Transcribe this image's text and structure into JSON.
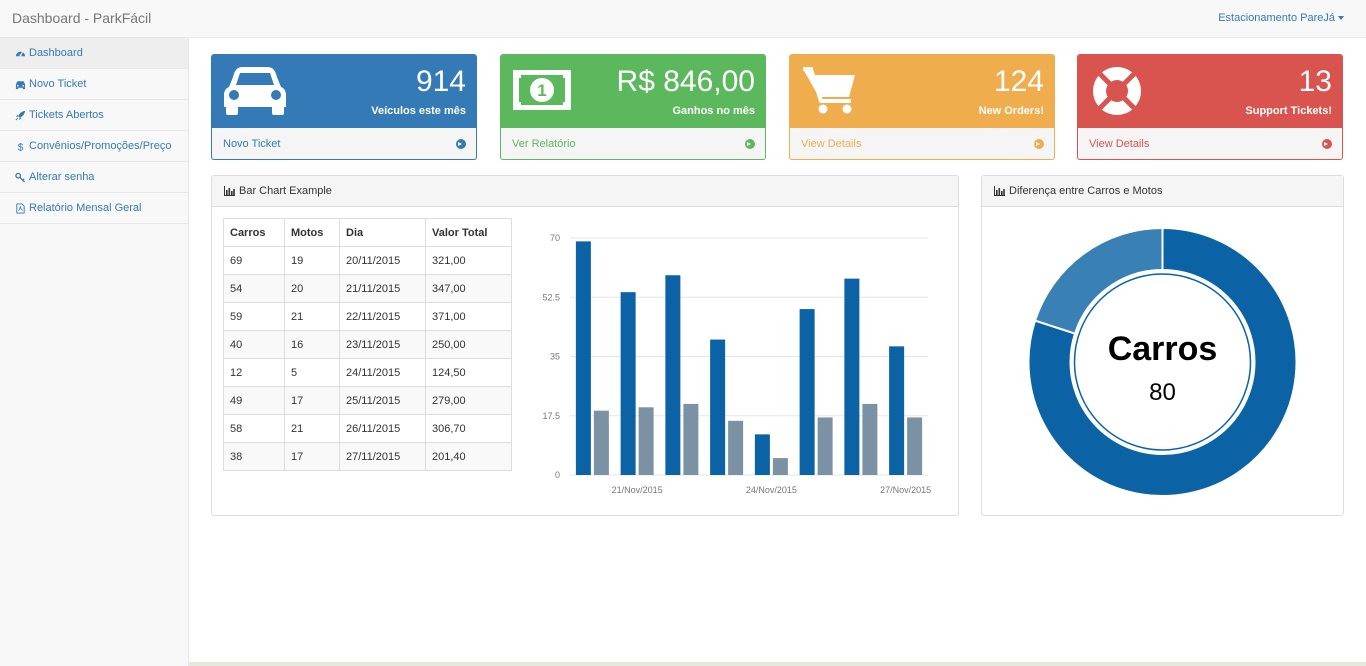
{
  "navbar": {
    "brand": "Dashboard - ParkFácil",
    "user": "Estacionamento PareJá"
  },
  "sidebar": {
    "items": [
      {
        "label": "Dashboard",
        "icon": "dashboard-icon"
      },
      {
        "label": "Novo Ticket",
        "icon": "car-icon"
      },
      {
        "label": "Tickets Abertos",
        "icon": "rocket-icon"
      },
      {
        "label": "Convênios/Promoções/Preço",
        "icon": "dollar-icon"
      },
      {
        "label": "Alterar senha",
        "icon": "key-icon"
      },
      {
        "label": "Relatório Mensal Geral",
        "icon": "pdf-file-icon"
      }
    ]
  },
  "cards": [
    {
      "value": "914",
      "label": "Veículos este mês",
      "link": "Novo Ticket",
      "color": "#337ab7",
      "icon": "car-icon"
    },
    {
      "value": "R$ 846,00",
      "label": "Ganhos no mês",
      "link": "Ver Relatório",
      "color": "#5cb85c",
      "icon": "money-icon"
    },
    {
      "value": "124",
      "label": "New Orders!",
      "link": "View Details",
      "color": "#f0ad4e",
      "icon": "shopping-cart-icon"
    },
    {
      "value": "13",
      "label": "Support Tickets!",
      "link": "View Details",
      "color": "#d9534f",
      "icon": "life-ring-icon"
    }
  ],
  "bar_panel": {
    "title": "Bar Chart Example",
    "table": {
      "headers": [
        "Carros",
        "Motos",
        "Dia",
        "Valor Total"
      ],
      "rows": [
        [
          "69",
          "19",
          "20/11/2015",
          "321,00"
        ],
        [
          "54",
          "20",
          "21/11/2015",
          "347,00"
        ],
        [
          "59",
          "21",
          "22/11/2015",
          "371,00"
        ],
        [
          "40",
          "16",
          "23/11/2015",
          "250,00"
        ],
        [
          "12",
          "5",
          "24/11/2015",
          "124,50"
        ],
        [
          "49",
          "17",
          "25/11/2015",
          "279,00"
        ],
        [
          "58",
          "21",
          "26/11/2015",
          "306,70"
        ],
        [
          "38",
          "17",
          "27/11/2015",
          "201,40"
        ]
      ]
    }
  },
  "donut_panel": {
    "title": "Diferença entre Carros e Motos",
    "center_label": "Carros",
    "center_value": "80"
  },
  "chart_data": [
    {
      "type": "bar",
      "categories": [
        "20/Nov/2015",
        "21/Nov/2015",
        "22/Nov/2015",
        "23/Nov/2015",
        "24/Nov/2015",
        "25/Nov/2015",
        "26/Nov/2015",
        "27/Nov/2015"
      ],
      "shown_x_ticks": [
        "21/Nov/2015",
        "24/Nov/2015",
        "27/Nov/2015"
      ],
      "series": [
        {
          "values": [
            69,
            54,
            59,
            40,
            12,
            49,
            58,
            38
          ],
          "color": "#0b62a4"
        },
        {
          "values": [
            19,
            20,
            21,
            16,
            5,
            17,
            21,
            17
          ],
          "color": "#7a92a3"
        }
      ],
      "yticks": [
        "0",
        "17.5",
        "35",
        "52.5",
        "70"
      ],
      "ylim": [
        0,
        70
      ],
      "grid": true
    },
    {
      "type": "pie",
      "donut": true,
      "slices": [
        {
          "label": "Carros",
          "value": 80,
          "color": "#0b62a4"
        },
        {
          "label": "Motos",
          "value": 20,
          "color": "#3980b5"
        }
      ]
    }
  ]
}
